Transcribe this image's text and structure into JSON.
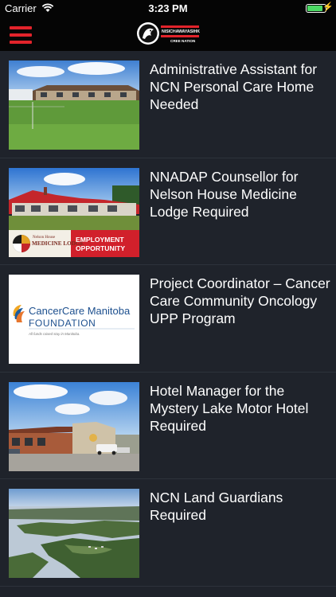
{
  "status_bar": {
    "carrier": "Carrier",
    "time": "3:23 PM"
  },
  "header": {
    "logo_line1": "NISICHAWAYASIHK",
    "logo_line2": "CREE NATION",
    "accent_color": "#e2232b"
  },
  "articles": [
    {
      "title": "Administrative Assistant for NCN Personal Care Home Needed",
      "image": "care-home-photo"
    },
    {
      "title": "NNADAP Counsellor for Nelson House Medicine Lodge Required",
      "image": "medicine-lodge-photo",
      "badge_left": "MEDICINE LODGE",
      "badge_left_small": "Nelson House",
      "badge_right": "EMPLOYMENT OPPORTUNITY"
    },
    {
      "title": "Project Coordinator – Cancer Care Community Oncology UPP Program",
      "image": "cancercare-logo",
      "logo_line1": "CancerCare Manitoba",
      "logo_line2": "FOUNDATION",
      "logo_tagline": "All funds raised stay in Manitoba."
    },
    {
      "title": "Hotel Manager for the Mystery Lake Motor Hotel Required",
      "image": "motor-hotel-photo"
    },
    {
      "title": "NCN Land Guardians Required",
      "image": "lake-aerial-photo"
    }
  ]
}
